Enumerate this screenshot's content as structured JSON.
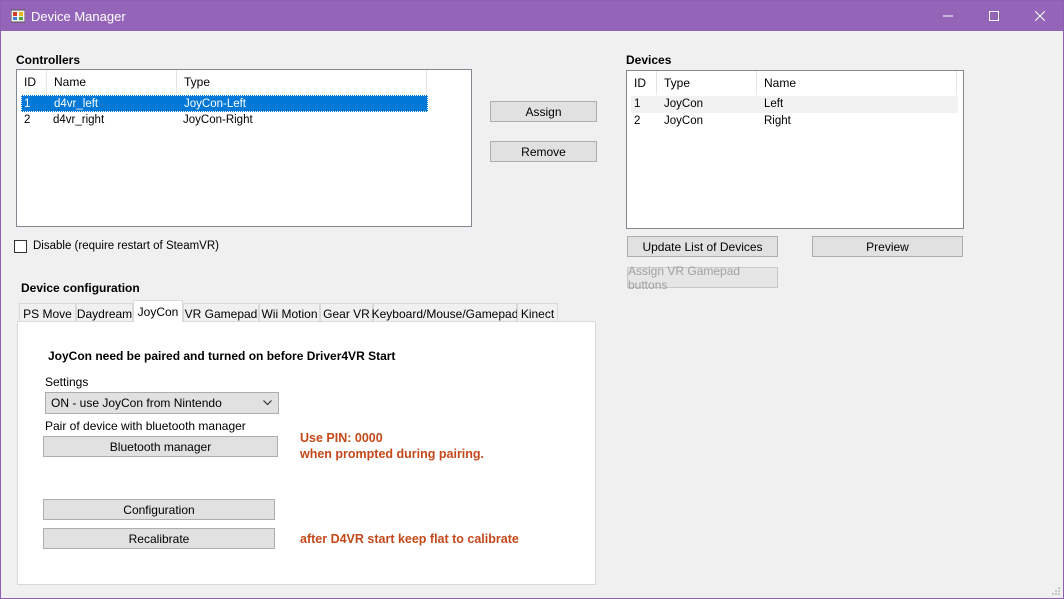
{
  "window": {
    "title": "Device Manager",
    "controls": [
      "minimize",
      "maximize",
      "close"
    ]
  },
  "controllers": {
    "title": "Controllers",
    "columns": [
      "ID",
      "Name",
      "Type"
    ],
    "rows": [
      {
        "id": "1",
        "name": "d4vr_left",
        "type": "JoyCon-Left",
        "selected": true
      },
      {
        "id": "2",
        "name": "d4vr_right",
        "type": "JoyCon-Right",
        "selected": false
      }
    ]
  },
  "actions": {
    "assign": "Assign",
    "remove": "Remove"
  },
  "devices": {
    "title": "Devices",
    "columns": [
      "ID",
      "Type",
      "Name"
    ],
    "rows": [
      {
        "id": "1",
        "type": "JoyCon",
        "name": "Left"
      },
      {
        "id": "2",
        "type": "JoyCon",
        "name": "Right"
      }
    ],
    "update_list": "Update List of Devices",
    "preview": "Preview",
    "assign_vr_gamepad": "Assign VR Gamepad buttons"
  },
  "disable_checkbox": {
    "label": "Disable (require restart of SteamVR)",
    "checked": false
  },
  "device_config": {
    "title": "Device configuration",
    "tabs": [
      "PS Move",
      "Daydream",
      "JoyCon",
      "VR Gamepad",
      "Wii Motion",
      "Gear VR",
      "Keyboard/Mouse/Gamepad",
      "Kinect"
    ],
    "active_tab": "JoyCon",
    "joycon": {
      "notice": "JoyCon need be paired and turned on before Driver4VR Start",
      "settings_label": "Settings",
      "settings_value": "ON - use JoyCon from Nintendo",
      "pair_label": "Pair of device with bluetooth manager",
      "bluetooth_button": "Bluetooth manager",
      "pin_line1": "Use PIN: 0000",
      "pin_line2": "when prompted during pairing.",
      "configuration_button": "Configuration",
      "recalibrate_button": "Recalibrate",
      "calibrate_hint": "after D4VR start keep flat to calibrate"
    }
  },
  "colors": {
    "titlebar": "#9364b8",
    "selection": "#0078d7",
    "hint_text": "#c4491a"
  }
}
